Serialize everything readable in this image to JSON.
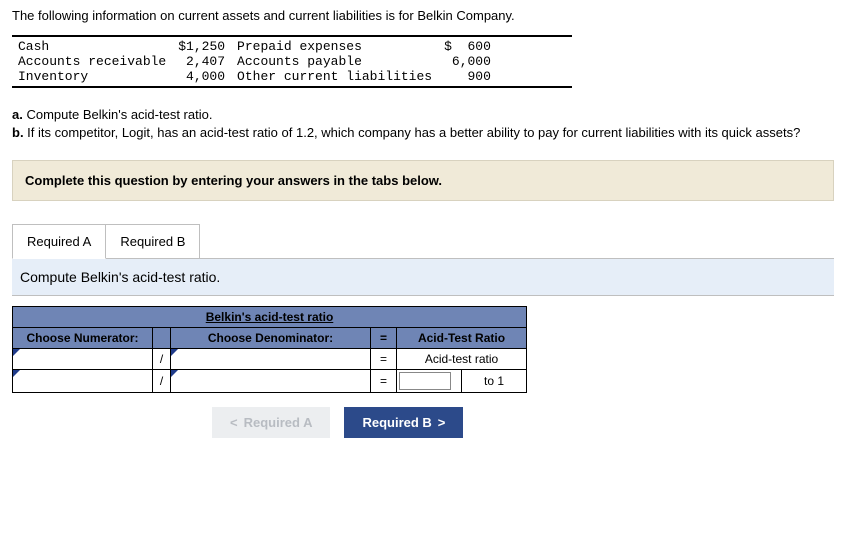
{
  "intro": "The following information on current assets and current liabilities is for Belkin Company.",
  "info": {
    "left": [
      {
        "label": "Cash",
        "value": "$1,250"
      },
      {
        "label": "Accounts receivable",
        "value": "2,407"
      },
      {
        "label": "Inventory",
        "value": "4,000"
      }
    ],
    "right": [
      {
        "label": "Prepaid expenses",
        "value": "$  600"
      },
      {
        "label": "Accounts payable",
        "value": "6,000"
      },
      {
        "label": "Other current liabilities",
        "value": "900"
      }
    ]
  },
  "questions": {
    "a_label": "a.",
    "a_text": " Compute Belkin's acid-test ratio.",
    "b_label": "b.",
    "b_text": " If its competitor, Logit, has an acid-test ratio of 1.2, which company has a better ability to pay for current liabilities with its quick assets?"
  },
  "hint": "Complete this question by entering your answers in the tabs below.",
  "tabs": {
    "a": "Required A",
    "b": "Required B"
  },
  "panel": {
    "instruction": "Compute Belkin's acid-test ratio.",
    "title": "Belkin's acid-test ratio",
    "choose_num": "Choose Numerator:",
    "choose_den": "Choose Denominator:",
    "acid_header": "Acid-Test Ratio",
    "acid_label": "Acid-test ratio",
    "to1": "to 1",
    "eq": "=",
    "slash": "/"
  },
  "nav": {
    "prev": "Required A",
    "prev_glyph": "<",
    "next": "Required B",
    "next_glyph": ">"
  }
}
